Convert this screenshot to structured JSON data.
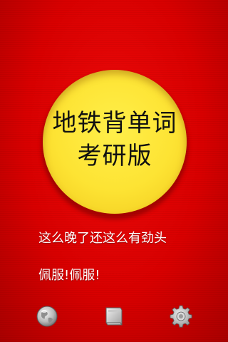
{
  "badge": {
    "title": "地铁背单词",
    "subtitle": "考研版"
  },
  "messages": [
    "这么晚了还这么有劲头",
    "佩服!佩服!"
  ],
  "toolbar": {
    "icons": [
      "globe-icon",
      "book-icon",
      "gear-icon"
    ]
  },
  "colors": {
    "background": "#d80000",
    "badge": "#fde333",
    "text_primary": "#111111",
    "message_text": "#ffffff"
  }
}
